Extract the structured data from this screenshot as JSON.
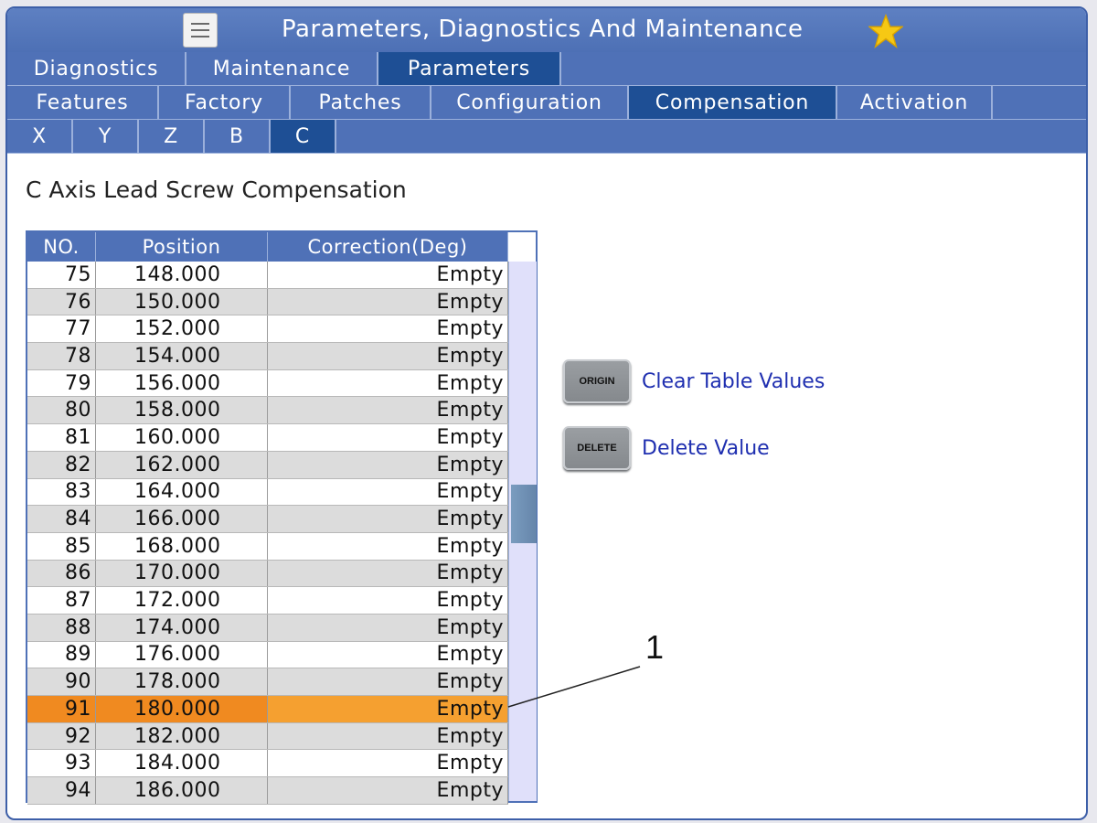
{
  "window": {
    "title": "Parameters, Diagnostics And Maintenance"
  },
  "icons": {
    "menu": "hamburger-menu-icon",
    "favorite": "star-icon"
  },
  "colors": {
    "accent": "#4f71b7",
    "active_tab": "#1e4f95",
    "selected_row": "#f5a030",
    "favorite_star": "#f6c814"
  },
  "tabs_level1": [
    {
      "label": "Diagnostics",
      "active": false
    },
    {
      "label": "Maintenance",
      "active": false
    },
    {
      "label": "Parameters",
      "active": true
    }
  ],
  "tabs_level2": [
    {
      "label": "Features",
      "active": false
    },
    {
      "label": "Factory",
      "active": false
    },
    {
      "label": "Patches",
      "active": false
    },
    {
      "label": "Configuration",
      "active": false
    },
    {
      "label": "Compensation",
      "active": true
    },
    {
      "label": "Activation",
      "active": false
    }
  ],
  "tabs_level3": [
    {
      "label": "X",
      "active": false
    },
    {
      "label": "Y",
      "active": false
    },
    {
      "label": "Z",
      "active": false
    },
    {
      "label": "B",
      "active": false
    },
    {
      "label": "C",
      "active": true
    }
  ],
  "page_title": "C Axis Lead Screw Compensation",
  "table": {
    "headers": [
      "NO.",
      "Position",
      "Correction(Deg)"
    ],
    "rows": [
      [
        "75",
        "148.000",
        "Empty"
      ],
      [
        "76",
        "150.000",
        "Empty"
      ],
      [
        "77",
        "152.000",
        "Empty"
      ],
      [
        "78",
        "154.000",
        "Empty"
      ],
      [
        "79",
        "156.000",
        "Empty"
      ],
      [
        "80",
        "158.000",
        "Empty"
      ],
      [
        "81",
        "160.000",
        "Empty"
      ],
      [
        "82",
        "162.000",
        "Empty"
      ],
      [
        "83",
        "164.000",
        "Empty"
      ],
      [
        "84",
        "166.000",
        "Empty"
      ],
      [
        "85",
        "168.000",
        "Empty"
      ],
      [
        "86",
        "170.000",
        "Empty"
      ],
      [
        "87",
        "172.000",
        "Empty"
      ],
      [
        "88",
        "174.000",
        "Empty"
      ],
      [
        "89",
        "176.000",
        "Empty"
      ],
      [
        "90",
        "178.000",
        "Empty"
      ],
      [
        "91",
        "180.000",
        "Empty"
      ],
      [
        "92",
        "182.000",
        "Empty"
      ],
      [
        "93",
        "184.000",
        "Empty"
      ],
      [
        "94",
        "186.000",
        "Empty"
      ]
    ],
    "selected_row_no": "91"
  },
  "actions": [
    {
      "key": "ORIGIN",
      "label": "Clear Table Values"
    },
    {
      "key": "DELETE",
      "label": "Delete Value"
    }
  ],
  "callout": {
    "number": "1"
  }
}
